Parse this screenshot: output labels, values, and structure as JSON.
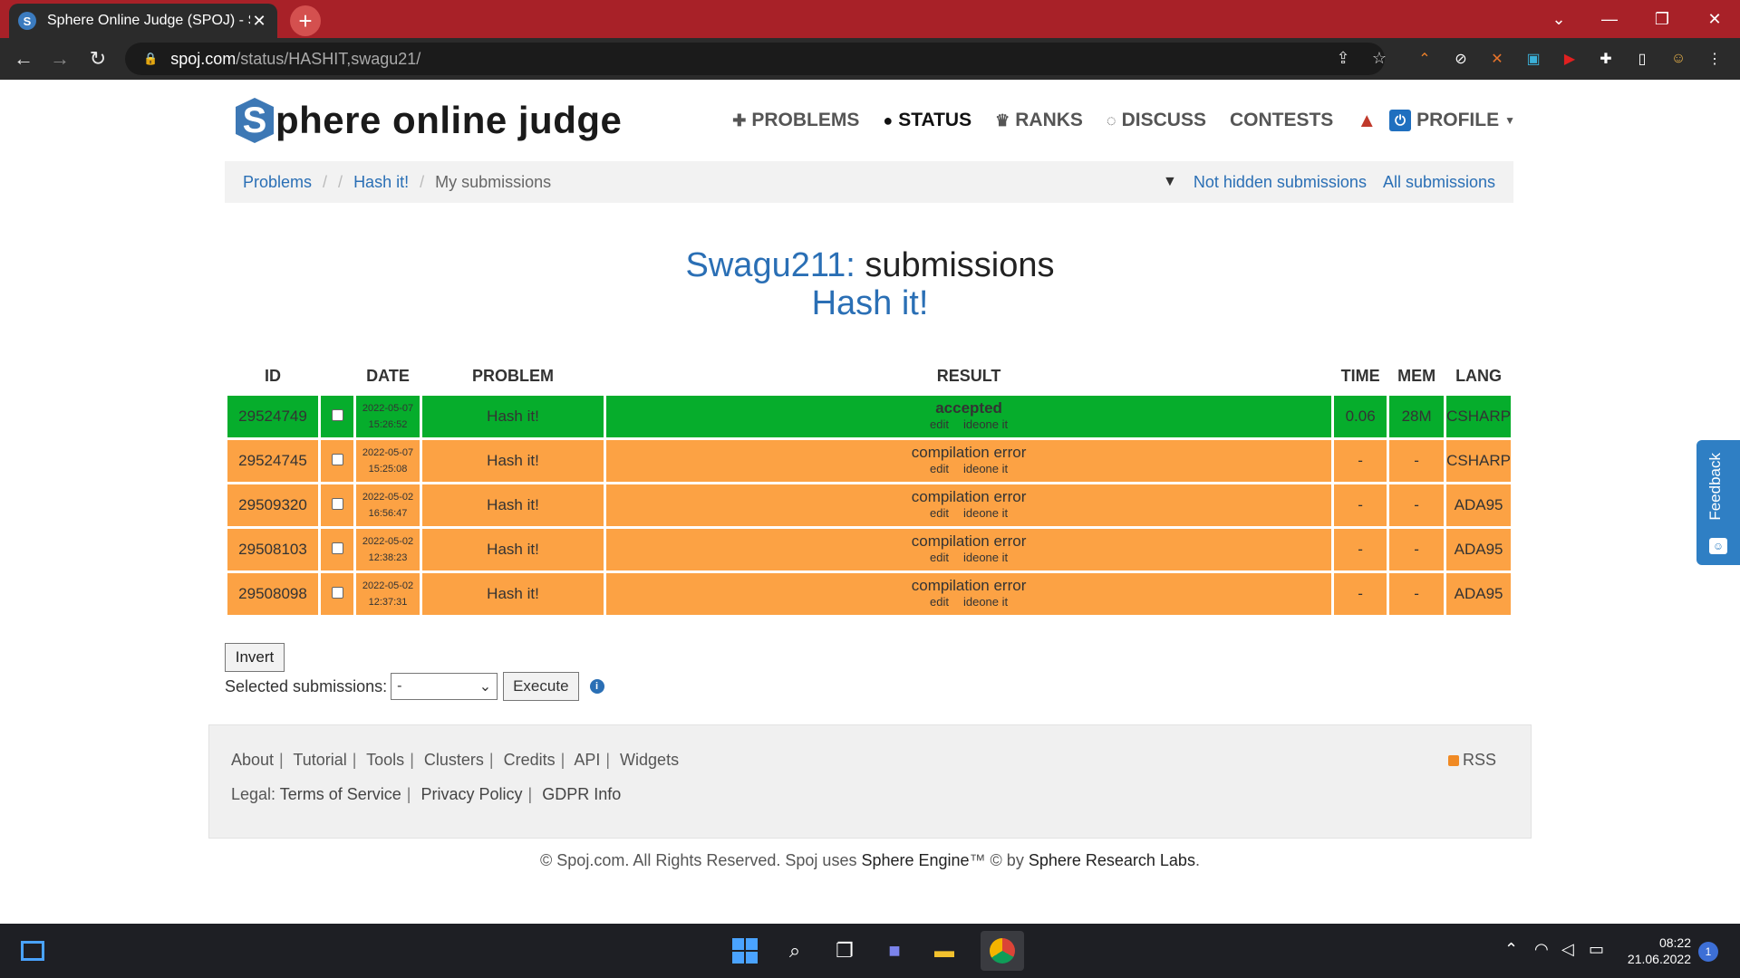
{
  "browser": {
    "tab_title": "Sphere Online Judge (SPOJ) - Sta",
    "favicon_letter": "S",
    "url_host": "spoj.com",
    "url_path": "/status/HASHIT,swagu21/"
  },
  "site": {
    "logo_letter": "S",
    "logo_text": "phere online judge",
    "nav": {
      "problems": "PROBLEMS",
      "status": "STATUS",
      "ranks": "RANKS",
      "discuss": "DISCUSS",
      "contests": "CONTESTS",
      "profile": "PROFILE"
    }
  },
  "breadcrumb": {
    "problems": "Problems",
    "problem": "Hash it!",
    "current": "My submissions",
    "not_hidden": "Not hidden submissions",
    "all": "All submissions"
  },
  "heading": {
    "user": "Swagu211:",
    "rest": " submissions",
    "problem": "Hash it!"
  },
  "table": {
    "headers": {
      "id": "ID",
      "date": "DATE",
      "problem": "PROBLEM",
      "result": "RESULT",
      "time": "TIME",
      "mem": "MEM",
      "lang": "LANG"
    },
    "rows": [
      {
        "id": "29524749",
        "date": "2022-05-07",
        "time_of_day": "15:26:52",
        "problem": "Hash it!",
        "result": "accepted",
        "edit": "edit",
        "ideone": "ideone it",
        "time": "0.06",
        "mem": "28M",
        "lang": "CSHARP",
        "status": "ok"
      },
      {
        "id": "29524745",
        "date": "2022-05-07",
        "time_of_day": "15:25:08",
        "problem": "Hash it!",
        "result": "compilation error",
        "edit": "edit",
        "ideone": "ideone it",
        "time": "-",
        "mem": "-",
        "lang": "CSHARP",
        "status": "ce"
      },
      {
        "id": "29509320",
        "date": "2022-05-02",
        "time_of_day": "16:56:47",
        "problem": "Hash it!",
        "result": "compilation error",
        "edit": "edit",
        "ideone": "ideone it",
        "time": "-",
        "mem": "-",
        "lang": "ADA95",
        "status": "ce"
      },
      {
        "id": "29508103",
        "date": "2022-05-02",
        "time_of_day": "12:38:23",
        "problem": "Hash it!",
        "result": "compilation error",
        "edit": "edit",
        "ideone": "ideone it",
        "time": "-",
        "mem": "-",
        "lang": "ADA95",
        "status": "ce"
      },
      {
        "id": "29508098",
        "date": "2022-05-02",
        "time_of_day": "12:37:31",
        "problem": "Hash it!",
        "result": "compilation error",
        "edit": "edit",
        "ideone": "ideone it",
        "time": "-",
        "mem": "-",
        "lang": "ADA95",
        "status": "ce"
      }
    ]
  },
  "actions": {
    "invert": "Invert",
    "selected_label": "Selected submissions:",
    "select_value": "-",
    "execute": "Execute"
  },
  "footer": {
    "links": [
      "About",
      "Tutorial",
      "Tools",
      "Clusters",
      "Credits",
      "API",
      "Widgets"
    ],
    "legal_label": "Legal:",
    "legal_links": [
      "Terms of Service",
      "Privacy Policy",
      "GDPR Info"
    ],
    "rss": "RSS",
    "copyright_prefix": "© Spoj.com. All Rights Reserved. Spoj uses ",
    "engine": "Sphere Engine",
    "copyright_mid": "™ © by ",
    "labs": "Sphere Research Labs",
    "copyright_end": "."
  },
  "feedback": {
    "label": "Feedback"
  },
  "taskbar": {
    "time": "08:22",
    "date": "21.06.2022",
    "notifications": "1"
  },
  "colors": {
    "accepted": "#06ad2c",
    "compilation_error": "#fca244",
    "link": "#2a6fb5",
    "browser_frame": "#a82128"
  }
}
